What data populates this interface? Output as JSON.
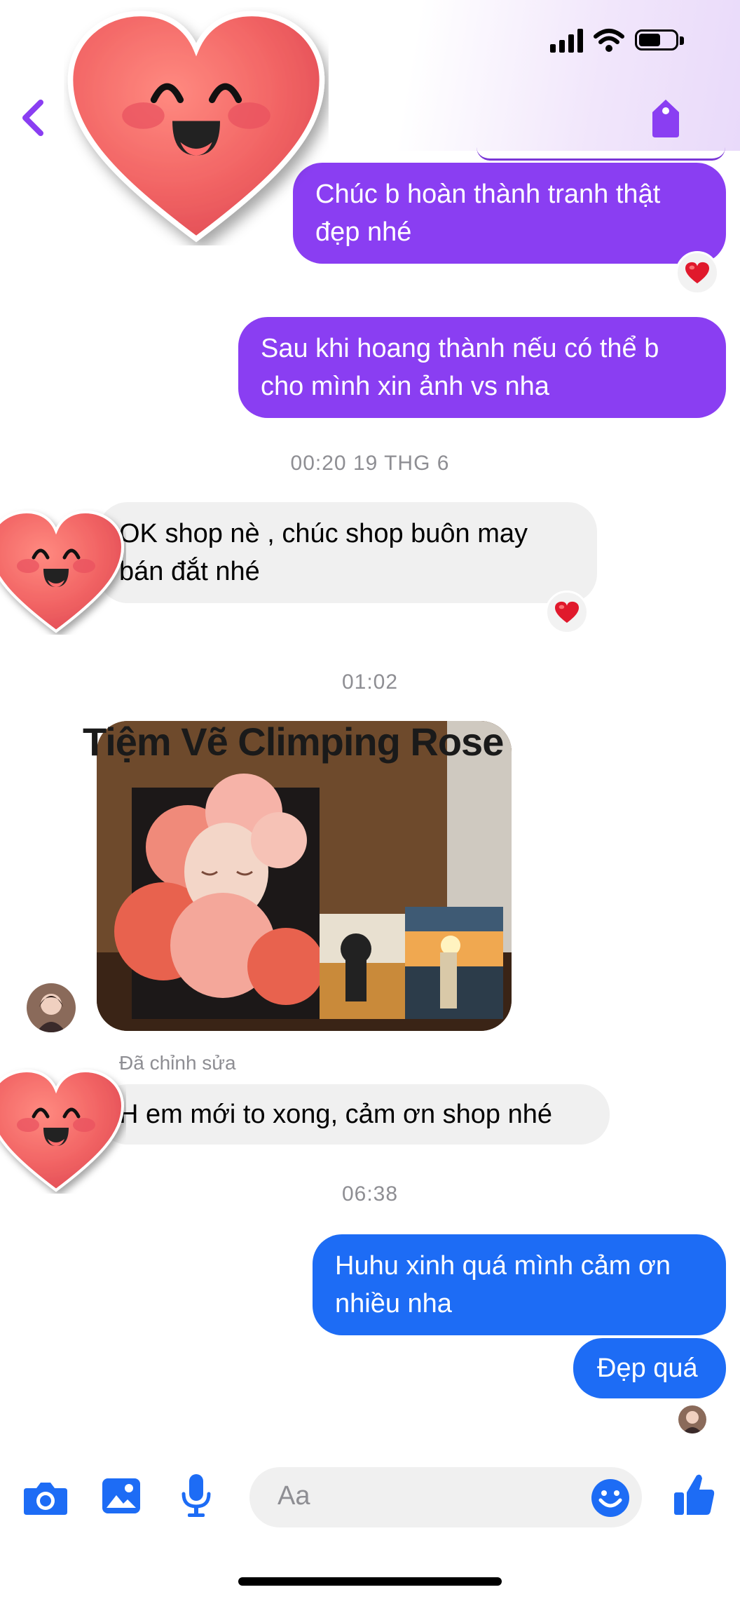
{
  "header": {
    "back_label": "<",
    "tag_icon": "tag-icon"
  },
  "messages": [
    {
      "id": "m1",
      "sender": "me",
      "text": "Chúc b hoàn thành tranh thật đẹp nhé",
      "reaction": "❤️"
    },
    {
      "id": "m2",
      "sender": "me",
      "text": "Sau khi hoang thành nếu có thể b cho mình xin ảnh vs nha"
    },
    {
      "id": "t1",
      "timestamp": "00:20 19 THG 6"
    },
    {
      "id": "m3",
      "sender": "them",
      "text": "OK shop nè , chúc shop buôn may bán đắt nhé",
      "reaction": "❤️"
    },
    {
      "id": "t2",
      "timestamp": "01:02"
    },
    {
      "id": "m4",
      "sender": "them",
      "type": "photo",
      "watermark": "Tiệm Vẽ Climping Rose"
    },
    {
      "id": "m5",
      "sender": "them",
      "edited_label": "Đã chỉnh sửa",
      "text": "H em mới to xong, cảm ơn shop nhé"
    },
    {
      "id": "t3",
      "timestamp": "06:38"
    },
    {
      "id": "m6",
      "sender": "me",
      "text": "Huhu xinh quá mình cảm ơn nhiều nha"
    },
    {
      "id": "m7",
      "sender": "me",
      "text": "Đẹp quá"
    }
  ],
  "composer": {
    "placeholder": "Aa",
    "icons": [
      "camera-icon",
      "photo-gallery-icon",
      "microphone-icon",
      "emoji-icon",
      "thumbs-up-icon"
    ]
  },
  "colors": {
    "purple": "#8a3ef2",
    "blue": "#1d6cf5",
    "gray_bubble": "#f0f0f0",
    "timestamp": "#8e8e93"
  }
}
